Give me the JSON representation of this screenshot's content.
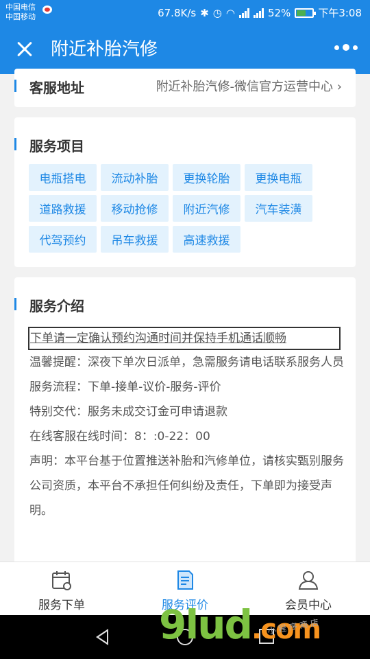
{
  "status_bar": {
    "carrier1": "中国电信",
    "carrier2": "中国移动",
    "speed": "67.8K/s",
    "battery": "52%",
    "time": "下午3:08"
  },
  "title_bar": {
    "title": "附近补胎汽修"
  },
  "address": {
    "label": "客服地址",
    "value": "附近补胎汽修-微信官方运营中心"
  },
  "services": {
    "heading": "服务项目",
    "items": [
      "电瓶搭电",
      "流动补胎",
      "更换轮胎",
      "更换电瓶",
      "道路救援",
      "移动抢修",
      "附近汽修",
      "汽车装潢",
      "代驾预约",
      "吊车救援",
      "高速救援"
    ]
  },
  "intro": {
    "heading": "服务介绍",
    "highlight": "下单请一定确认预约沟通时间并保持手机通话顺畅",
    "lines": [
      "温馨提醒：深夜下单次日派单，急需服务请电话联系服务人员",
      "服务流程：下单-接单-议价-服务-评价",
      "特别交代：服务未成交订金可申请退款",
      "在线客服在线时间：8：:0-22：00",
      "声明：本平台基于位置推送补胎和汽修单位，请核实甄别服务公司资质，本平台不承担任何纠纷及责任，下单即为接受声明。"
    ]
  },
  "bottom_nav": {
    "items": [
      {
        "label": "服务下单",
        "icon": "calendar-icon"
      },
      {
        "label": "服务评价",
        "icon": "document-icon"
      },
      {
        "label": "会员中心",
        "icon": "user-icon"
      }
    ],
    "active": "服务评价"
  },
  "watermark": {
    "main": "9lud",
    "suffix": ".com",
    "sub": "小 程 序 商 店"
  },
  "colors": {
    "primary": "#1e88e5",
    "tag_bg": "#e3f2fd",
    "background": "#f2f2f2"
  }
}
